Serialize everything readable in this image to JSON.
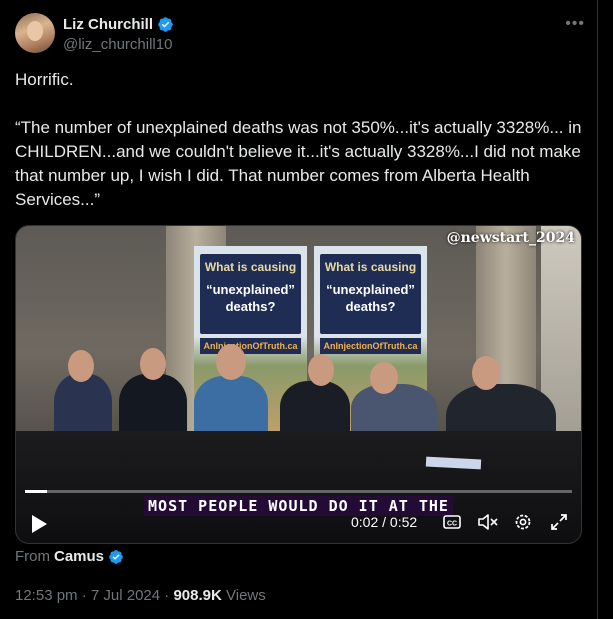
{
  "author": {
    "display_name": "Liz Churchill",
    "handle": "@liz_churchill10",
    "verified_color": "#1d9bf0"
  },
  "more_icon": "more-horizontal-icon",
  "tweet": {
    "lines": [
      "Horrific.",
      "“The number of unexplained deaths was not 350%...it's actually 3328%... in CHILDREN...and we couldn't believe it...it's actually 3328%...I did not make that number up, I wish I did. That number comes from Alberta Health Services...”"
    ]
  },
  "video": {
    "watermark": "@newstart_2024",
    "banner_title": "What is causing",
    "banner_quote": "“unexplained” deaths?",
    "banner_url": "AnInjectionOfTruth.ca",
    "subtitle": "MOST PEOPLE WOULD DO IT AT THE",
    "time_current": "0:02",
    "time_separator": "/",
    "time_total": "0:52",
    "progress": 0.04,
    "controls": [
      "play-icon",
      "captions-icon",
      "mute-icon",
      "settings-icon",
      "fullscreen-icon"
    ]
  },
  "source": {
    "prefix": "From",
    "name": "Camus"
  },
  "meta": {
    "time": "12:53 pm",
    "sep1": "·",
    "date": "7 Jul 2024",
    "sep2": "·",
    "views_count": "908.9K",
    "views_label": "Views"
  }
}
